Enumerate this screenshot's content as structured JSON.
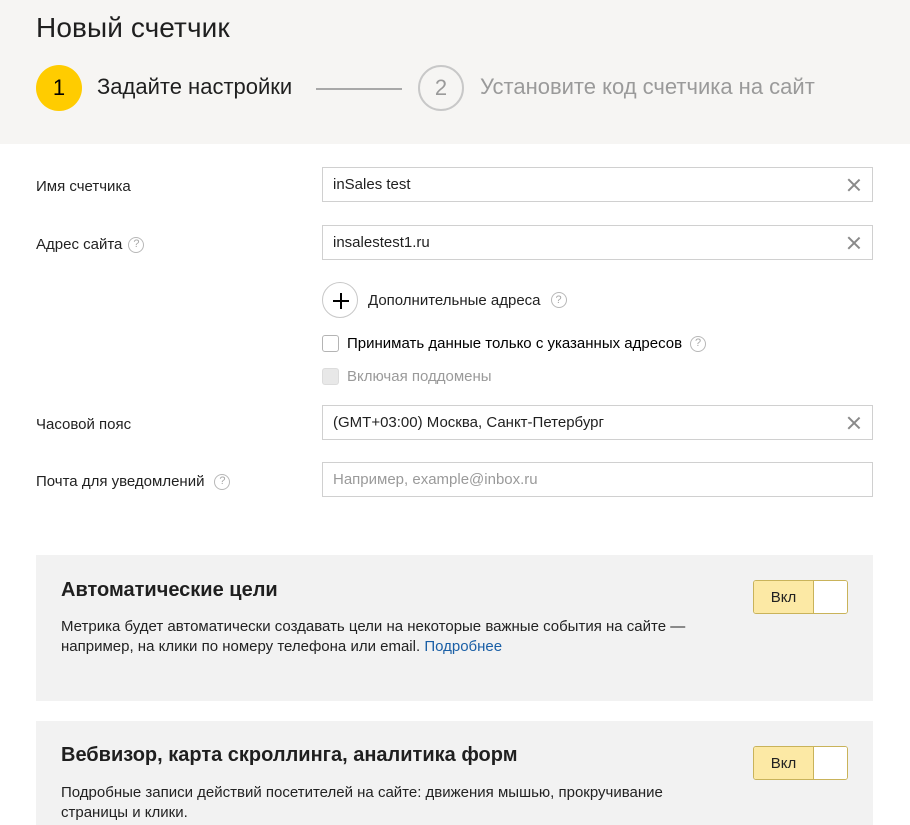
{
  "header": {
    "title": "Новый счетчик",
    "steps": [
      {
        "number": "1",
        "label": "Задайте настройки"
      },
      {
        "number": "2",
        "label": "Установите код счетчика на сайт"
      }
    ]
  },
  "form": {
    "counter_name": {
      "label": "Имя счетчика",
      "value": "inSales test"
    },
    "site_address": {
      "label": "Адрес сайта",
      "value": "insalestest1.ru"
    },
    "additional_addresses": {
      "label": "Дополнительные адреса"
    },
    "accept_only_listed": {
      "label": "Принимать данные только с указанных адресов",
      "checked": false
    },
    "include_subdomains": {
      "label": "Включая поддомены",
      "checked": false,
      "disabled": true
    },
    "timezone": {
      "label": "Часовой пояс",
      "value": "(GMT+03:00) Москва, Санкт-Петербург"
    },
    "notification_email": {
      "label": "Почта для уведомлений",
      "value": "",
      "placeholder": "Например, example@inbox.ru"
    }
  },
  "help_glyph": "?",
  "panels": [
    {
      "title": "Автоматические цели",
      "description": "Метрика будет автоматически создавать цели на некоторые важные события на сайте — например, на клики по номеру телефона или email.",
      "link": "Подробнее",
      "toggle_label": "Вкл"
    },
    {
      "title": "Вебвизор, карта скроллинга, аналитика форм",
      "description": "Подробные записи действий посетителей на сайте: движения мышью, прокручивание страницы и клики.",
      "toggle_label": "Вкл"
    }
  ],
  "colors": {
    "accent": "#ffcc00",
    "header_bg": "#f6f5f3",
    "panel_bg": "#f2f2f2",
    "link": "#1a5fa6",
    "toggle_on": "#fce9a5"
  }
}
